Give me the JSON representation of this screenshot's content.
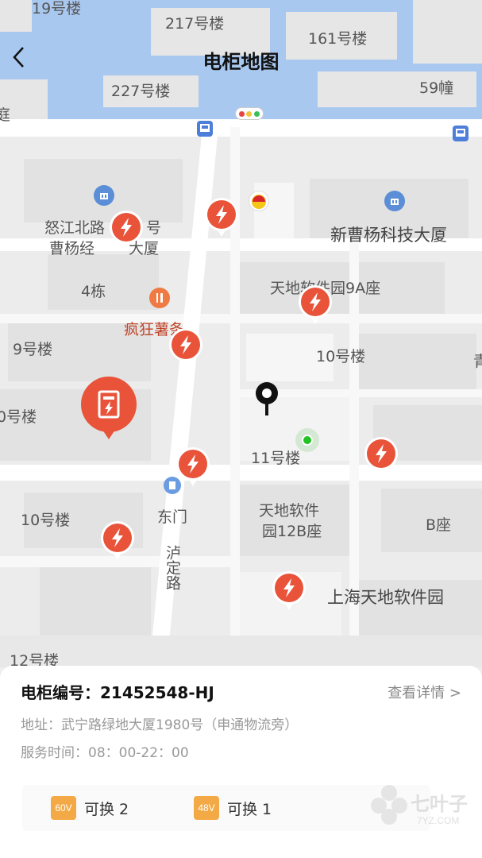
{
  "header": {
    "title": "电柜地图",
    "back_icon": "chevron-left-icon"
  },
  "map": {
    "labels": {
      "b19": "19号楼",
      "b217": "217号楼",
      "b161": "161号楼",
      "b227": "227号楼",
      "b59": "59幢",
      "edge_left": "庭",
      "nujiang": "怒江北路",
      "hao": "号",
      "caoyang": "曹杨经",
      "dasha": "大厦",
      "xincaoyang": "新曹杨科技大厦",
      "dong4": "4栋",
      "tiandi9a": "天地软件园9A座",
      "fengkuang": "疯狂薯条",
      "b9": "9号楼",
      "b10a": "10号楼",
      "edge_right": "青",
      "b0": "0号楼",
      "b11": "11号楼",
      "dongmen": "东门",
      "b10b": "10号楼",
      "tiandi12b_1": "天地软件",
      "tiandi12b_2": "园12B座",
      "bzuo": "B座",
      "hudinglu": "泸定路",
      "shanghai_tiandi": "上海天地软件园",
      "b12": "12号楼"
    }
  },
  "cabinet": {
    "id_label": "电柜编号：",
    "id": "21452548-HJ",
    "detail_link": "查看详情 >",
    "address": "地址：武宁路绿地大厦1980号（申通物流旁）",
    "hours": "服务时间：08：00-22：00",
    "stock": [
      {
        "voltage": "60V",
        "text": "可换 2",
        "color": "#f3a945"
      },
      {
        "voltage": "48V",
        "text": "可换 1",
        "color": "#f3a945"
      }
    ]
  },
  "watermark": {
    "text": "七叶子",
    "sub": "7YZ.COM"
  },
  "colors": {
    "pin": "#e8533a",
    "water": "#a9c8ef",
    "road": "#ffffff",
    "accent": "#f3a945"
  }
}
